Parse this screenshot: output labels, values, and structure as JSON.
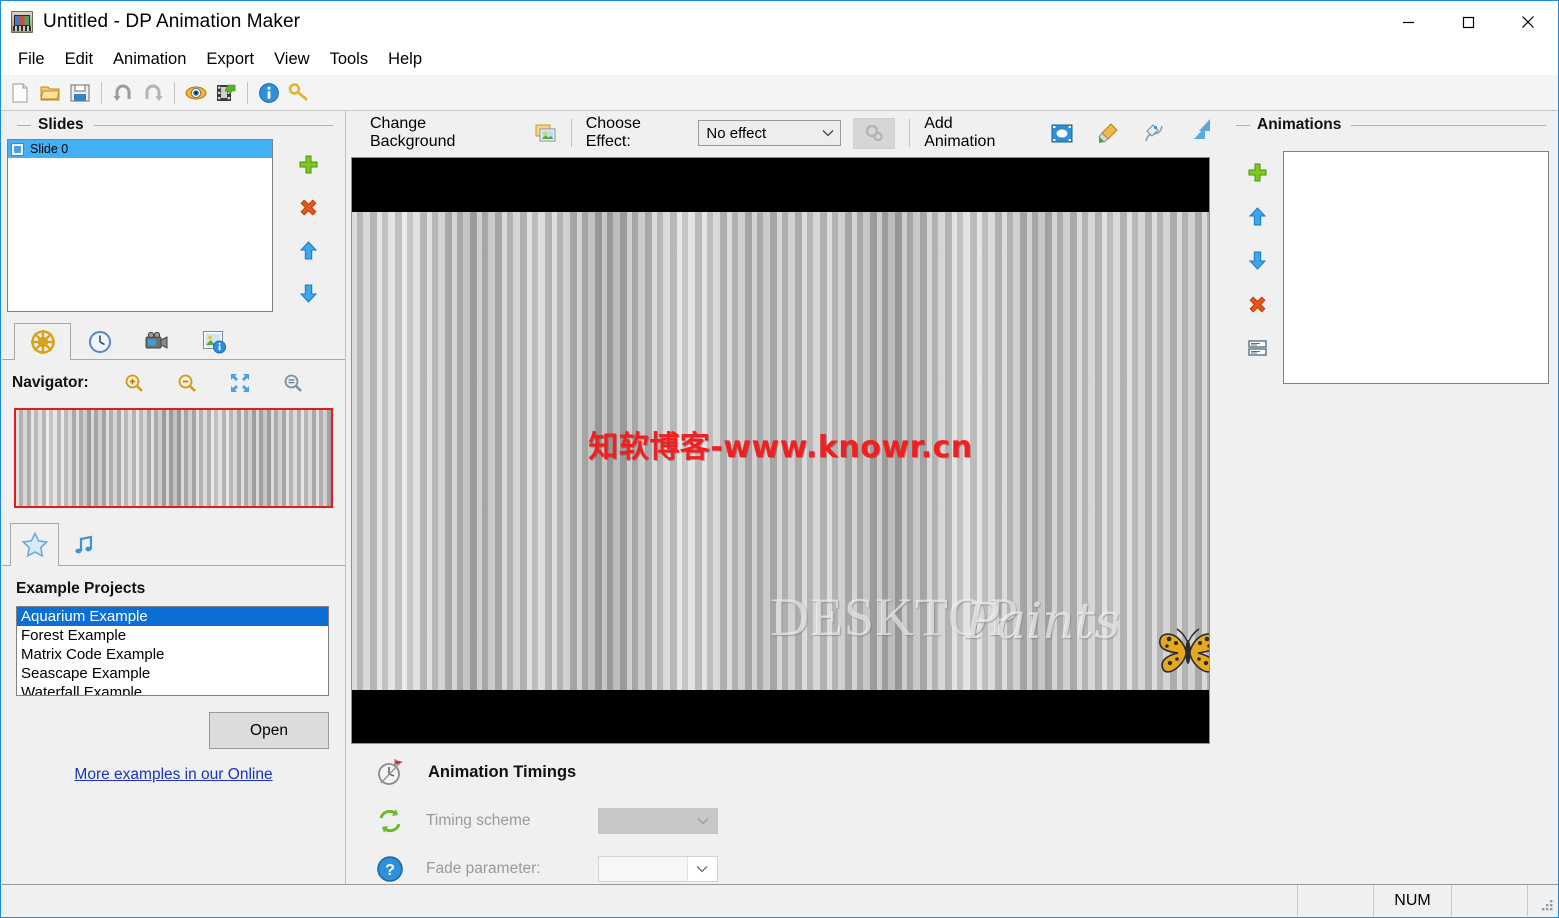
{
  "window": {
    "title": "Untitled - DP Animation Maker",
    "app_icon": "film-projector-icon",
    "controls": {
      "minimize": "minimize-icon",
      "maximize": "maximize-icon",
      "close": "close-icon"
    }
  },
  "menubar": {
    "items": [
      {
        "label": "File"
      },
      {
        "label": "Edit"
      },
      {
        "label": "Animation"
      },
      {
        "label": "Export"
      },
      {
        "label": "View"
      },
      {
        "label": "Tools"
      },
      {
        "label": "Help"
      }
    ]
  },
  "toolbar": {
    "buttons": [
      {
        "name": "new-icon"
      },
      {
        "name": "open-icon"
      },
      {
        "name": "save-icon"
      },
      {
        "name": "undo-icon"
      },
      {
        "name": "redo-icon"
      },
      {
        "name": "preview-eye-icon"
      },
      {
        "name": "export-video-icon"
      },
      {
        "name": "info-icon"
      },
      {
        "name": "key-register-icon"
      }
    ]
  },
  "slides": {
    "group_title": "Slides",
    "items": [
      {
        "label": "Slide 0",
        "selected": true
      }
    ],
    "buttons": [
      {
        "name": "add-slide-button"
      },
      {
        "name": "delete-slide-button"
      },
      {
        "name": "move-slide-up-button"
      },
      {
        "name": "move-slide-down-button"
      }
    ]
  },
  "left_tabs": {
    "items": [
      {
        "name": "tab-settings",
        "icon": "ship-wheel-icon",
        "active": true
      },
      {
        "name": "tab-timing",
        "icon": "clock-icon",
        "active": false
      },
      {
        "name": "tab-video",
        "icon": "camcorder-icon",
        "active": false
      },
      {
        "name": "tab-image-info",
        "icon": "image-info-icon",
        "active": false
      }
    ]
  },
  "navigator": {
    "label": "Navigator:",
    "buttons": [
      {
        "name": "zoom-in-icon"
      },
      {
        "name": "zoom-out-icon"
      },
      {
        "name": "fit-to-window-icon"
      },
      {
        "name": "actual-size-icon"
      }
    ]
  },
  "bottom_tabs": {
    "items": [
      {
        "name": "tab-examples",
        "icon": "star-icon",
        "active": true
      },
      {
        "name": "tab-music",
        "icon": "music-note-icon",
        "active": false
      }
    ]
  },
  "examples": {
    "title": "Example Projects",
    "items": [
      {
        "label": "Aquarium Example",
        "selected": true
      },
      {
        "label": "Forest Example",
        "selected": false
      },
      {
        "label": "Matrix Code Example",
        "selected": false
      },
      {
        "label": "Seascape Example",
        "selected": false
      },
      {
        "label": "Waterfall Example",
        "selected": false
      }
    ],
    "open_label": "Open",
    "more_link": "More examples in our Online"
  },
  "center_toolbar": {
    "change_background_label": "Change Background",
    "change_background_icon": "background-image-icon",
    "choose_effect_label": "Choose Effect:",
    "effect_value": "No effect",
    "effect_options": [
      "No effect"
    ],
    "effect_settings_icon": "gears-icon",
    "add_animation_label": "Add Animation",
    "add_animation_buttons": [
      {
        "name": "add-video-animation-icon"
      },
      {
        "name": "brush-animation-icon"
      },
      {
        "name": "pen-path-animation-icon"
      },
      {
        "name": "gradient-animation-icon"
      }
    ]
  },
  "canvas": {
    "watermark_red": "知软博客-www.knowr.cn",
    "watermark_brand_bold": "DESKTOP",
    "watermark_brand_script": "Paints",
    "butterfly_icon": "butterfly-icon",
    "letterbox_color": "#000000"
  },
  "timings": {
    "title": "Animation Timings",
    "title_icon": "stopwatch-flag-icon",
    "rows": [
      {
        "icon": "refresh-cycle-icon",
        "label": "Timing scheme",
        "value": "",
        "disabled": true
      },
      {
        "icon": "help-question-icon",
        "label": "Fade parameter:",
        "value": "",
        "disabled": true
      }
    ]
  },
  "animations": {
    "group_title": "Animations",
    "corner_icon": "gradient-animation-icon",
    "buttons": [
      {
        "name": "add-animation-button"
      },
      {
        "name": "move-animation-up-button"
      },
      {
        "name": "move-animation-down-button"
      },
      {
        "name": "delete-animation-button"
      },
      {
        "name": "animation-properties-button"
      }
    ],
    "items": []
  },
  "statusbar": {
    "message": "",
    "indicators": [
      "NUM"
    ],
    "resize_grip": "resize-grip-icon"
  },
  "colors": {
    "accent": "#0b6fd6",
    "selection": "#41b0f5",
    "window_border": "#1f8ae0",
    "panel_bg": "#f0f0f0",
    "watermark_red": "#f02020",
    "link": "#1a33c2"
  }
}
